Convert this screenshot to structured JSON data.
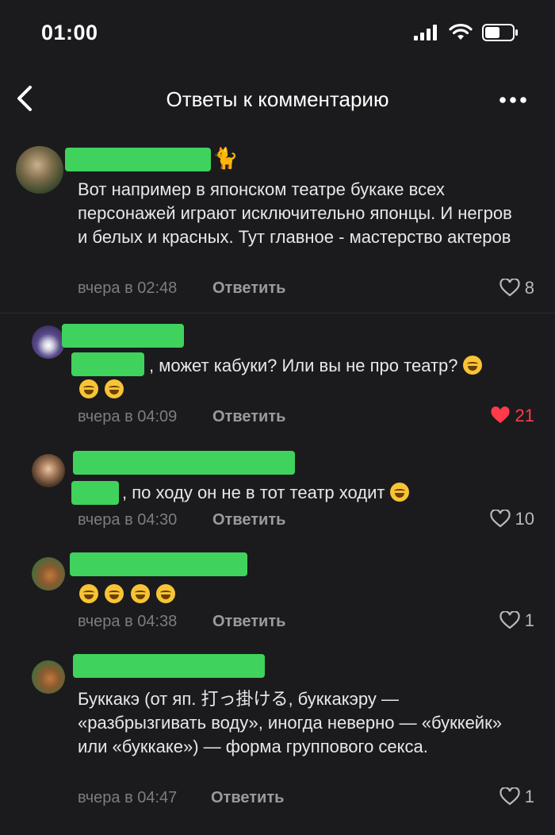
{
  "status": {
    "time": "01:00"
  },
  "nav": {
    "title": "Ответы к комментарию"
  },
  "comments": [
    {
      "text": "Вот например в японском театре букаке всех персонажей играют исключительно японцы. И негров и белых и красных. Тут главное - мастерство актеров",
      "name_suffix": "🐈",
      "time": "вчера в 02:48",
      "reply": "Ответить",
      "likes": "8",
      "liked": false
    },
    {
      "text": ", может кабуки? Или вы не про театр?",
      "time": "вчера в 04:09",
      "reply": "Ответить",
      "likes": "21",
      "liked": true
    },
    {
      "text": ", по ходу он не в тот театр ходит",
      "time": "вчера в 04:30",
      "reply": "Ответить",
      "likes": "10",
      "liked": false
    },
    {
      "text": "",
      "time": "вчера в 04:38",
      "reply": "Ответить",
      "likes": "1",
      "liked": false
    },
    {
      "text": "Буккакэ (от яп. 打っ掛ける, буккакэру — «разбрызгивать воду», иногда неверно — «буккейк» или «буккаке») — форма группового секса.",
      "time": "вчера в 04:47",
      "reply": "Ответить",
      "likes": "1",
      "liked": false
    }
  ],
  "colors": {
    "background": "#1b1b1d",
    "censor": "#3fd25c",
    "liked": "#ff3b4a",
    "meta": "#7c7c82"
  },
  "icons": [
    "back-icon",
    "more-icon",
    "heart-icon",
    "signal-icon",
    "wifi-icon",
    "battery-icon"
  ]
}
